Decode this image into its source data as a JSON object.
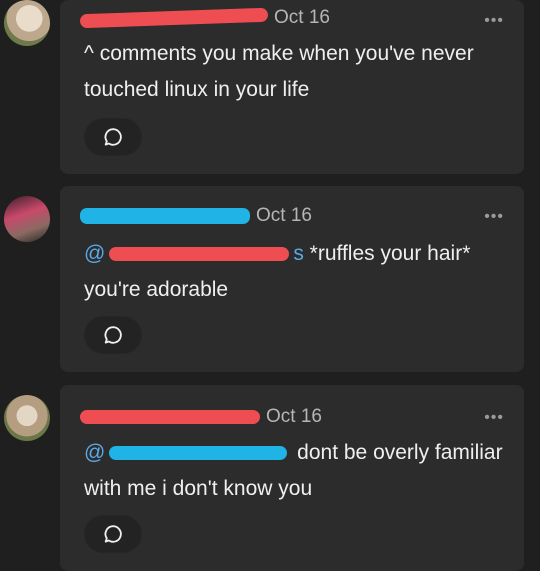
{
  "comments": [
    {
      "author_redacted": true,
      "date": "Oct 16",
      "more_label": "•••",
      "mention": "",
      "text": "^ comments you make when you've never touched linux in your life",
      "reply_icon": "speech-bubble-icon"
    },
    {
      "author_redacted": true,
      "date": "Oct 16",
      "more_label": "•••",
      "mention": "@",
      "mention_tail": "s",
      "text": "*ruffles your hair* you're adorable",
      "reply_icon": "speech-bubble-icon"
    },
    {
      "author_redacted": true,
      "date": "Oct 16",
      "more_label": "•••",
      "mention": "@",
      "text": "dont be overly familiar with me i don't know you",
      "reply_icon": "speech-bubble-icon"
    }
  ],
  "colors": {
    "background": "#1f1f1f",
    "card": "#2c2c2c",
    "mention": "#5aa9e6",
    "redaction_red": "#ee4d52",
    "redaction_blue": "#1fb3e6"
  }
}
